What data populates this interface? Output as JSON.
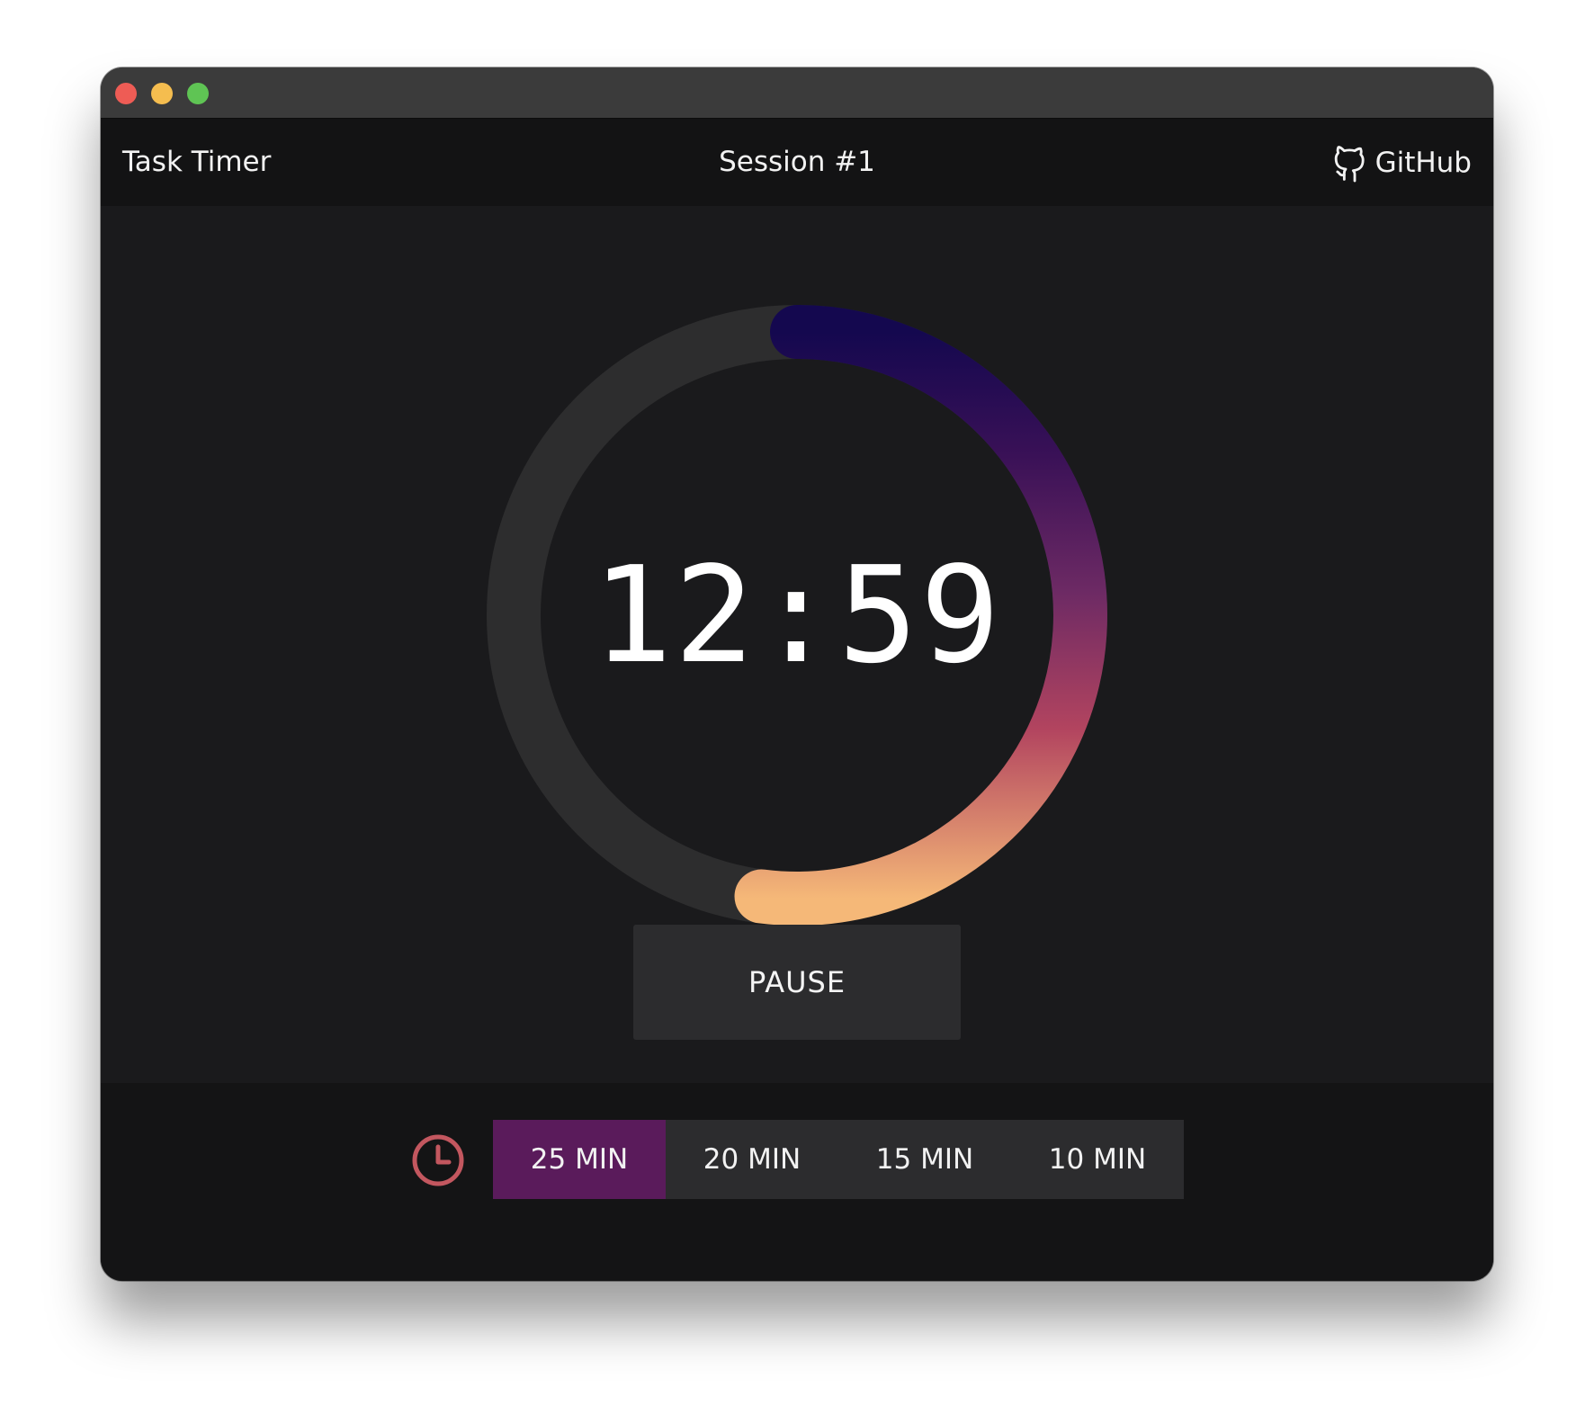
{
  "window": {
    "traffic_lights": [
      "close",
      "minimize",
      "zoom"
    ]
  },
  "header": {
    "app_title": "Task Timer",
    "session_title": "Session #1",
    "github_label": "GitHub",
    "github_icon": "github-icon"
  },
  "timer": {
    "time": "12:59",
    "progress_fraction": 0.52,
    "gradient_colors": [
      "#14084f",
      "#3a1157",
      "#6d2a64",
      "#b2445f",
      "#f5b878"
    ],
    "track_color": "#2d2d2e"
  },
  "controls": {
    "pause_label": "PAUSE"
  },
  "durations": {
    "icon": "clock-icon",
    "icon_color": "#c3575f",
    "active_color": "#5a1b5b",
    "options": [
      "25 MIN",
      "20 MIN",
      "15 MIN",
      "10 MIN"
    ],
    "selected": "25 MIN"
  }
}
